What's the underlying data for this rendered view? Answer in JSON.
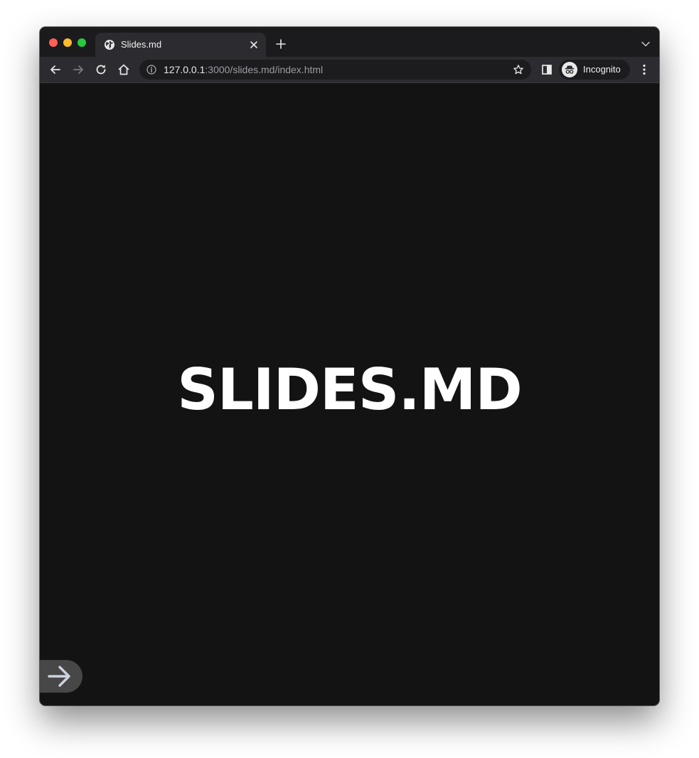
{
  "browser": {
    "tab": {
      "title": "Slides.md",
      "favicon": "globe-icon"
    },
    "address_bar": {
      "url_host": "127.0.0.1",
      "url_rest": ":3000/slides.md/index.html"
    },
    "profile": {
      "label": "Incognito",
      "icon": "incognito-icon"
    }
  },
  "slide": {
    "title": "SLIDES.MD",
    "background": "#131313",
    "next_control_icon": "arrow-right-icon"
  }
}
